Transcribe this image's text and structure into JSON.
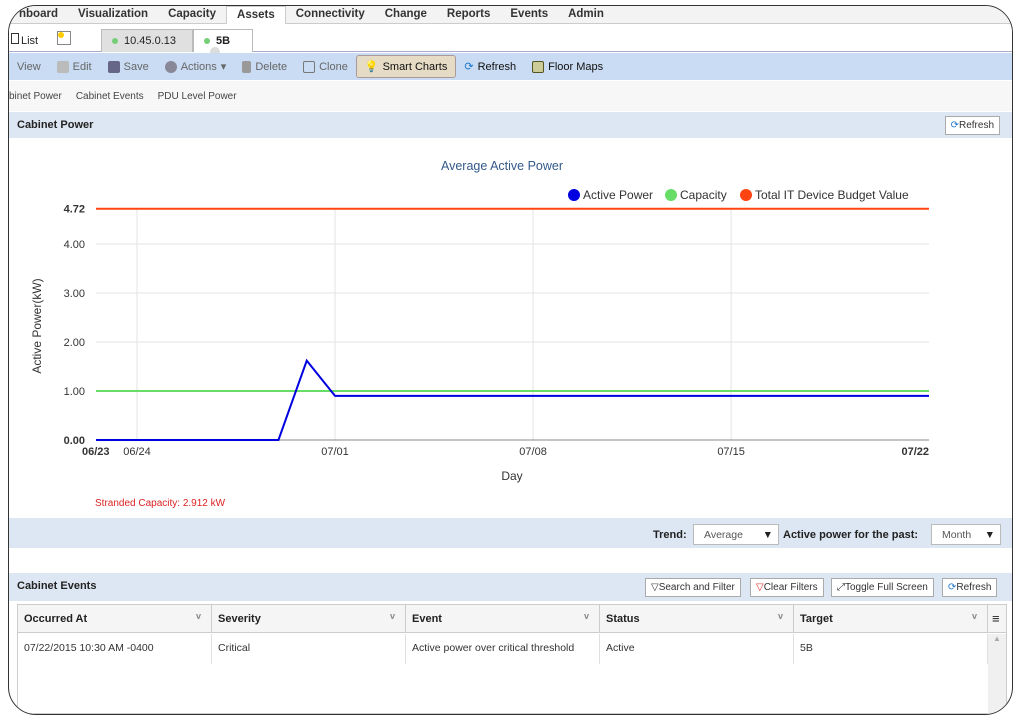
{
  "menu": [
    "hboard",
    "Visualization",
    "Capacity",
    "Assets",
    "Connectivity",
    "Change",
    "Reports",
    "Events",
    "Admin"
  ],
  "tabs": {
    "list": "List",
    "t1": "10.45.0.13",
    "t2": "5B"
  },
  "toolbar": {
    "view": "View",
    "edit": "Edit",
    "save": "Save",
    "actions": "Actions",
    "delete": "Delete",
    "clone": "Clone",
    "smart": "Smart Charts",
    "refresh": "Refresh",
    "floor": "Floor Maps"
  },
  "subnav": [
    "binet Power",
    "Cabinet Events",
    "PDU Level Power"
  ],
  "cabinet_power": {
    "title": "Cabinet Power",
    "refresh": "Refresh",
    "stranded": "Stranded Capacity: 2.912 kW"
  },
  "trend": {
    "label": "Trend:",
    "value": "Average",
    "past_label": "Active power for the past:",
    "past_value": "Month"
  },
  "events": {
    "title": "Cabinet Events",
    "search": "Search and Filter",
    "clear": "Clear Filters",
    "toggle": "Toggle Full Screen",
    "refresh": "Refresh",
    "columns": [
      "Occurred At",
      "Severity",
      "Event",
      "Status",
      "Target"
    ],
    "rows": [
      [
        "07/22/2015 10:30 AM -0400",
        "Critical",
        "Active power over critical threshold",
        "Active",
        "5B"
      ]
    ]
  },
  "chart_data": {
    "type": "line",
    "title": "Average Active Power",
    "xlabel": "Day",
    "ylabel": "Active Power(kW)",
    "x_ticks": [
      "06/23",
      "06/24",
      "07/01",
      "07/08",
      "07/15",
      "07/22"
    ],
    "y_ticks": [
      "0.00",
      "1.00",
      "2.00",
      "3.00",
      "4.00",
      "4.72"
    ],
    "ylim": [
      0,
      4.72
    ],
    "grid": true,
    "legend": "top-right",
    "series": [
      {
        "name": "Active Power",
        "color": "#0000e0",
        "points": [
          [
            "06/23",
            0
          ],
          [
            "06/29",
            0
          ],
          [
            "06/30",
            1.62
          ],
          [
            "07/01",
            0.9
          ],
          [
            "07/22",
            0.9
          ]
        ]
      },
      {
        "name": "Capacity",
        "color": "#66dd66",
        "points": [
          [
            "06/23",
            1.0
          ],
          [
            "07/22",
            1.0
          ]
        ]
      },
      {
        "name": "Total IT Device Budget Value",
        "color": "#ff4411",
        "points": [
          [
            "06/23",
            4.72
          ],
          [
            "07/22",
            4.72
          ]
        ]
      }
    ]
  }
}
